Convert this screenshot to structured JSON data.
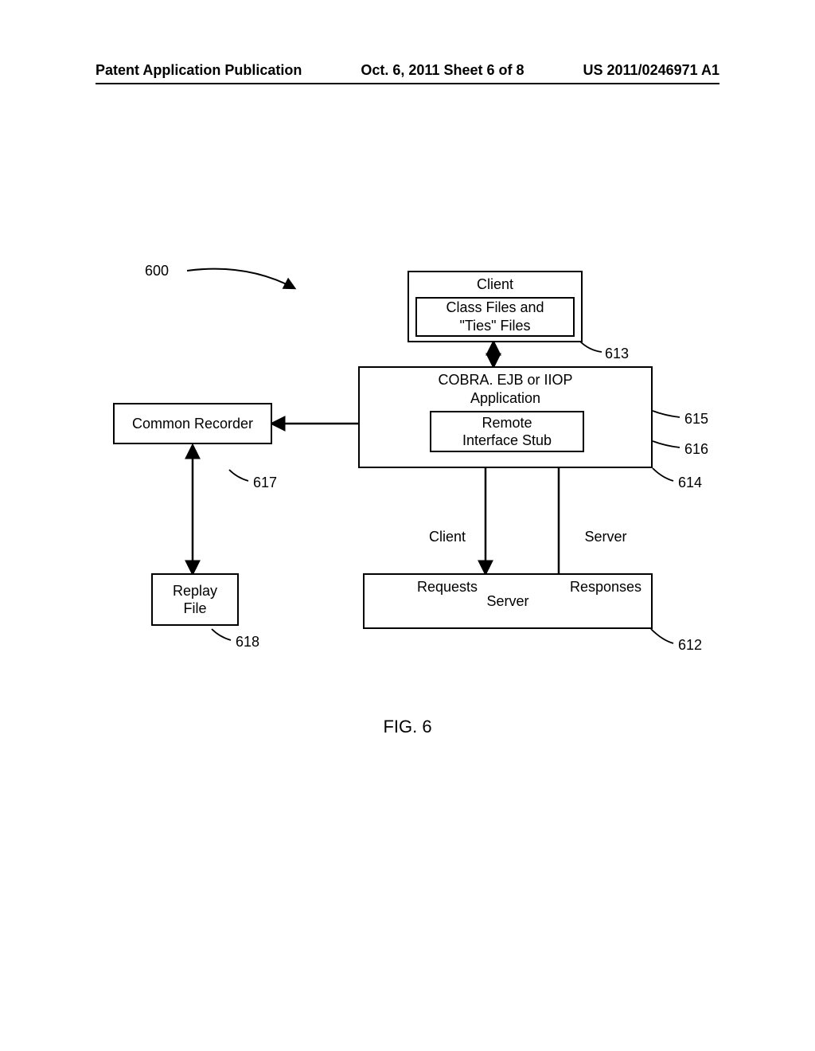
{
  "header": {
    "left": "Patent Application Publication",
    "mid": "Oct. 6, 2011  Sheet 6 of 8",
    "right": "US 2011/0246971 A1"
  },
  "figure_label": "FIG. 6",
  "refs": {
    "main": "600",
    "server_ref": "612",
    "classfiles_ref": "613",
    "app_ref": "614",
    "remote_ref_a": "615",
    "remote_ref_b": "616",
    "recorder_ref": "617",
    "replay_ref": "618"
  },
  "boxes": {
    "client_title": "Client",
    "class_files_l1": "Class Files and",
    "class_files_l2": "\"Ties\" Files",
    "app_l1": "COBRA. EJB or IIOP",
    "app_l2": "Application",
    "remote_l1": "Remote",
    "remote_l2": "Interface Stub",
    "recorder": "Common Recorder",
    "replay_l1": "Replay",
    "replay_l2": "File",
    "server": "Server"
  },
  "labels": {
    "client_requests_l1": "Client",
    "client_requests_l2": "Requests",
    "server_responses_l1": "Server",
    "server_responses_l2": "Responses"
  }
}
